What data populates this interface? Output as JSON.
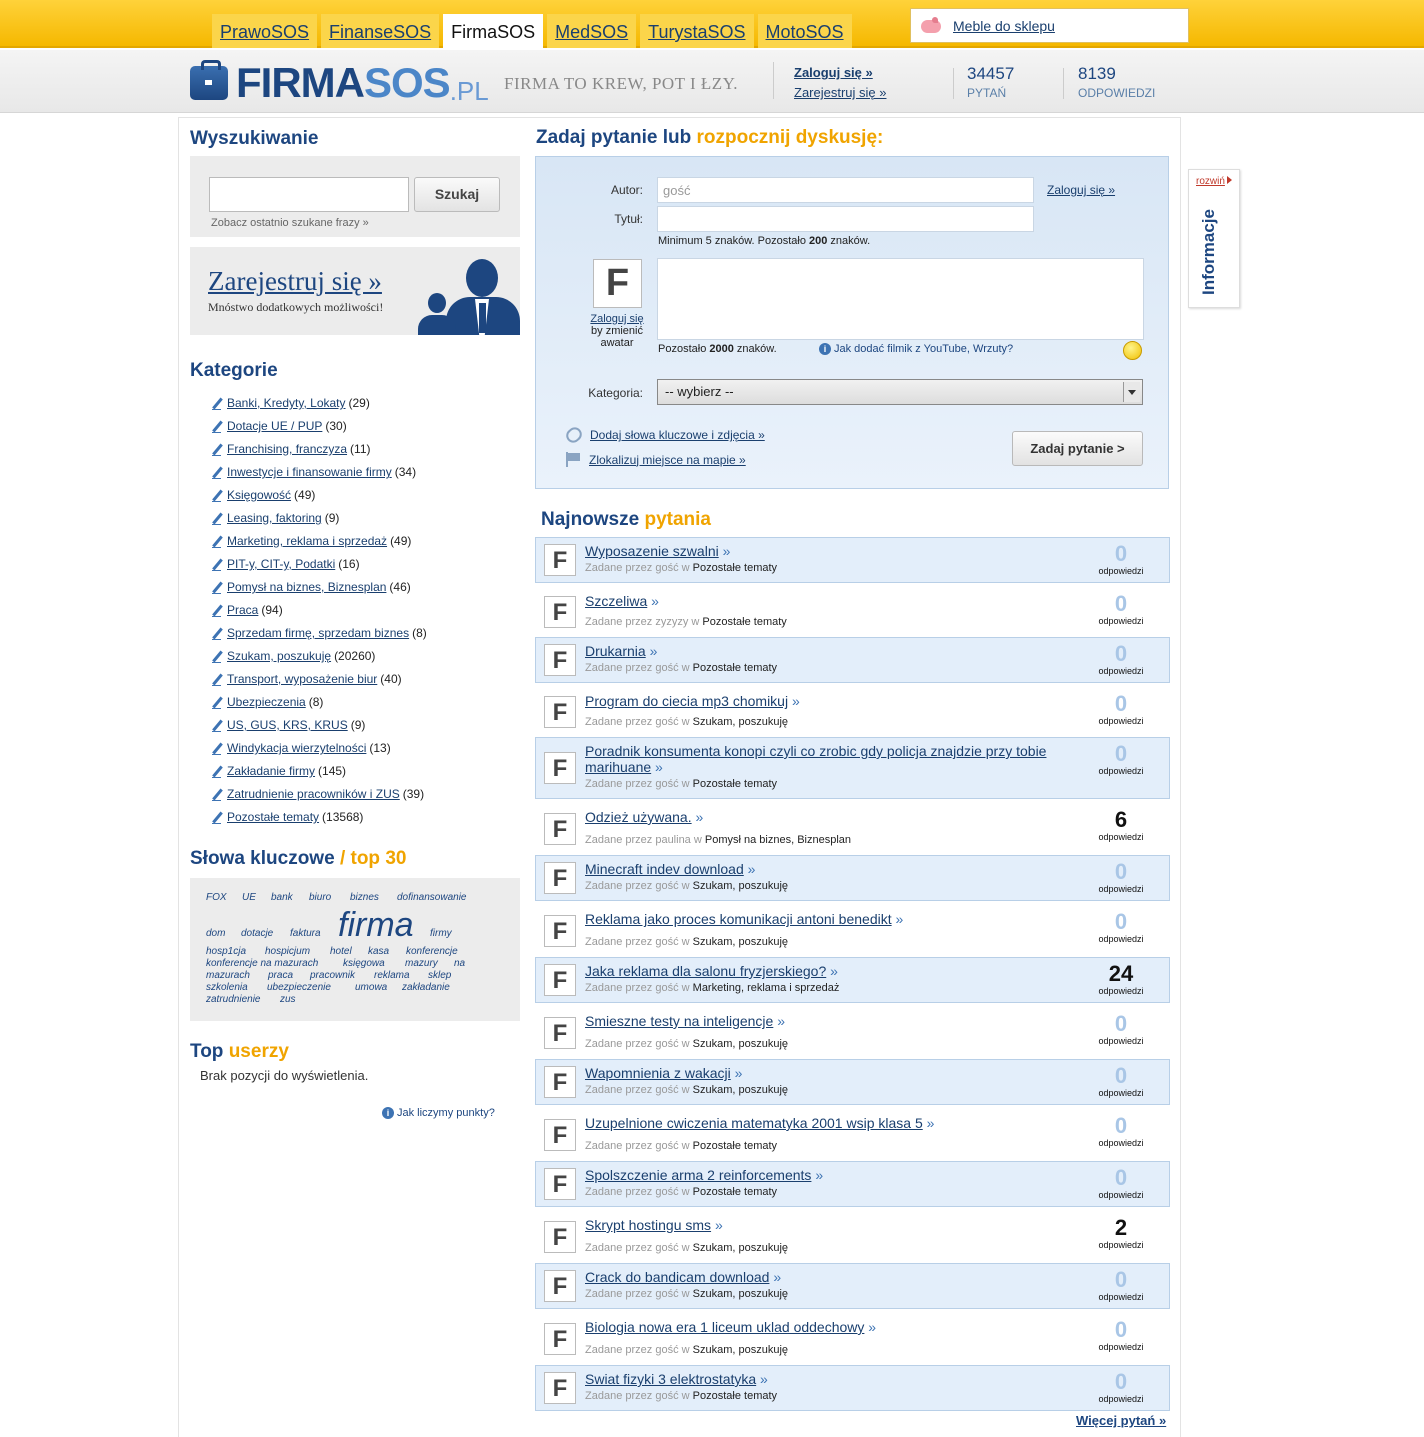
{
  "nav": {
    "tabs": [
      {
        "label": "PrawoSOS",
        "active": false
      },
      {
        "label": "FinanseSOS",
        "active": false
      },
      {
        "label": "FirmaSOS",
        "active": true
      },
      {
        "label": "MedSOS",
        "active": false
      },
      {
        "label": "TurystaSOS",
        "active": false
      },
      {
        "label": "MotoSOS",
        "active": false
      }
    ],
    "shop_link": "Meble do sklepu"
  },
  "header": {
    "logo_firma": "FIRMA",
    "logo_sos": "SOS",
    "logo_pl": ".PL",
    "slogan": "FIRMA TO KREW, POT I ŁZY.",
    "login": "Zaloguj się »",
    "register": "Zarejestruj się »",
    "questions_count": "34457",
    "questions_label": "PYTAŃ",
    "answers_count": "8139",
    "answers_label": "ODPOWIEDZI"
  },
  "search": {
    "title": "Wyszukiwanie",
    "button": "Szukaj",
    "recent": "Zobacz ostatnio szukane frazy »"
  },
  "register_promo": {
    "link": "Zarejestruj się »",
    "subtitle": "Mnóstwo dodatkowych możliwości!"
  },
  "categories": {
    "title": "Kategorie",
    "items": [
      {
        "name": "Banki, Kredyty, Lokaty",
        "count": "(29)"
      },
      {
        "name": "Dotacje UE / PUP",
        "count": "(30)"
      },
      {
        "name": "Franchising, franczyza",
        "count": "(11)"
      },
      {
        "name": "Inwestycje i finansowanie firmy",
        "count": "(34)"
      },
      {
        "name": "Księgowość",
        "count": "(49)"
      },
      {
        "name": "Leasing, faktoring",
        "count": "(9)"
      },
      {
        "name": "Marketing, reklama i sprzedaż",
        "count": "(49)"
      },
      {
        "name": "PIT-y, CIT-y, Podatki",
        "count": "(16)"
      },
      {
        "name": "Pomysł na biznes, Biznesplan",
        "count": "(46)"
      },
      {
        "name": "Praca",
        "count": "(94)"
      },
      {
        "name": "Sprzedam firmę, sprzedam biznes",
        "count": "(8)"
      },
      {
        "name": "Szukam, poszukuję",
        "count": "(20260)"
      },
      {
        "name": "Transport, wyposażenie biur",
        "count": "(40)"
      },
      {
        "name": "Ubezpieczenia",
        "count": "(8)"
      },
      {
        "name": "US, GUS, KRS, KRUS",
        "count": "(9)"
      },
      {
        "name": "Windykacja wierzytelności",
        "count": "(13)"
      },
      {
        "name": "Zakładanie firmy",
        "count": "(145)"
      },
      {
        "name": "Zatrudnienie pracowników i ZUS",
        "count": "(39)"
      },
      {
        "name": "Pozostałe tematy",
        "count": "(13568)"
      }
    ]
  },
  "keywords": {
    "title": "Słowa kluczowe",
    "title_accent": "/ top 30",
    "words": [
      "FOX",
      "UE",
      "bank",
      "biuro",
      "biznes",
      "dofinansowanie",
      "dom",
      "dotacje",
      "faktura",
      "firma",
      "firmy",
      "hosp1cja",
      "hospicjum",
      "hotel",
      "kasa",
      "konferencje",
      "konferencje na mazurach",
      "księgowa",
      "mazury",
      "na",
      "mazurach",
      "praca",
      "pracownik",
      "reklama",
      "sklep",
      "szkolenia",
      "ubezpieczenie",
      "umowa",
      "zakładanie",
      "zatrudnienie",
      "zus"
    ]
  },
  "top_users": {
    "title": "Top",
    "title_accent": "userzy",
    "empty": "Brak pozycji do wyświetlenia.",
    "points_link": "Jak liczymy punkty?"
  },
  "ask": {
    "title": "Zadaj pytanie lub",
    "title_accent": "rozpocznij dyskusję:",
    "author_label": "Autor:",
    "author_value": "gość",
    "login_link": "Zaloguj się »",
    "title_label": "Tytuł:",
    "title_note_pre": "Minimum 5 znaków.  Pozostało ",
    "title_note_num": "200",
    "title_note_post": " znaków.",
    "avatar_letter": "F",
    "avatar_login": "Zaloguj się",
    "avatar_caption": "by zmienić awatar",
    "body_note_pre": "Pozostało ",
    "body_note_num": "2000",
    "body_note_post": " znaków.",
    "video_help": "Jak dodać filmik z YouTube, Wrzuty?",
    "category_label": "Kategoria:",
    "category_value": "-- wybierz --",
    "add_keywords": "Dodaj słowa kluczowe i zdjęcia »",
    "locate_map": "Zlokalizuj miejsce na mapie »",
    "submit": "Zadaj pytanie >"
  },
  "questions": {
    "title": "Najnowsze",
    "title_accent": "pytania",
    "by_label": "Zadane przez",
    "in_label": "w",
    "answers_label": "odpowiedzi",
    "more": "Więcej pytań »",
    "items": [
      {
        "title": "Wyposazenie szwalni",
        "author": "gość",
        "category": "Pozostałe tematy",
        "answers": 0
      },
      {
        "title": "Szczeliwa",
        "author": "zyzyzy",
        "category": "Pozostałe tematy",
        "answers": 0
      },
      {
        "title": "Drukarnia",
        "author": "gość",
        "category": "Pozostałe tematy",
        "answers": 0
      },
      {
        "title": "Program do ciecia mp3 chomikuj",
        "author": "gość",
        "category": "Szukam, poszukuję",
        "answers": 0
      },
      {
        "title": "Poradnik konsumenta konopi czyli co zrobic gdy policja znajdzie przy tobie marihuane",
        "author": "gość",
        "category": "Pozostałe tematy",
        "answers": 0
      },
      {
        "title": "Odzież używana.",
        "author": "paulina",
        "category": "Pomysł na biznes, Biznesplan",
        "answers": 6
      },
      {
        "title": "Minecraft indev download",
        "author": "gość",
        "category": "Szukam, poszukuję",
        "answers": 0
      },
      {
        "title": "Reklama jako proces komunikacji antoni benedikt",
        "author": "gość",
        "category": "Szukam, poszukuję",
        "answers": 0
      },
      {
        "title": "Jaka reklama dla salonu fryzjerskiego?",
        "author": "gość",
        "category": "Marketing, reklama i sprzedaż",
        "answers": 24
      },
      {
        "title": "Smieszne testy na inteligencje",
        "author": "gość",
        "category": "Szukam, poszukuję",
        "answers": 0
      },
      {
        "title": "Wapomnienia z wakacji",
        "author": "gość",
        "category": "Szukam, poszukuję",
        "answers": 0
      },
      {
        "title": "Uzupelnione cwiczenia matematyka 2001 wsip klasa 5",
        "author": "gość",
        "category": "Pozostałe tematy",
        "answers": 0
      },
      {
        "title": "Spolszczenie arma 2 reinforcements",
        "author": "gość",
        "category": "Pozostałe tematy",
        "answers": 0
      },
      {
        "title": "Skrypt hostingu sms",
        "author": "gość",
        "category": "Szukam, poszukuję",
        "answers": 2
      },
      {
        "title": "Crack do bandicam download",
        "author": "gość",
        "category": "Szukam, poszukuję",
        "answers": 0
      },
      {
        "title": "Biologia nowa era 1 liceum uklad oddechowy",
        "author": "gość",
        "category": "Szukam, poszukuję",
        "answers": 0
      },
      {
        "title": "Swiat fizyki 3 elektrostatyka",
        "author": "gość",
        "category": "Pozostałe tematy",
        "answers": 0
      }
    ]
  },
  "side_tab": {
    "expand": "rozwiń",
    "label": "Informacje"
  }
}
